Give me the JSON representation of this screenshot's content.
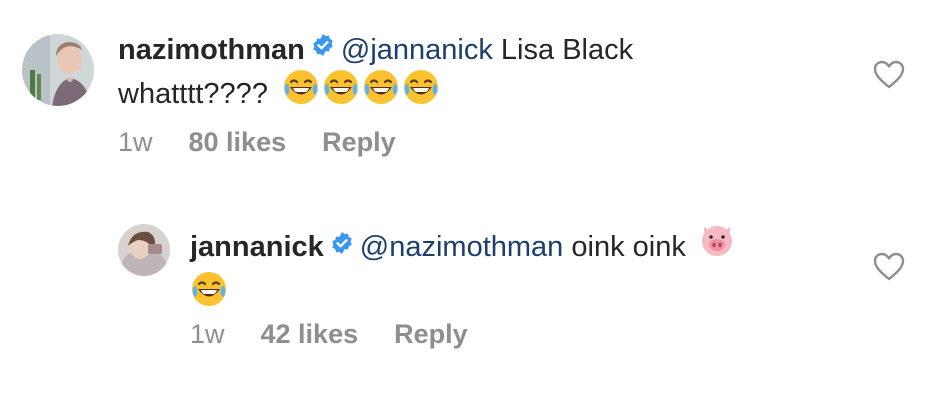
{
  "comments": [
    {
      "username": "nazimothman",
      "mention": "@jannanick",
      "text_after_mention": " Lisa Black",
      "text_line2": "whatttt????",
      "emojis": [
        "laughing-tears",
        "laughing-tears",
        "laughing-tears",
        "laughing-tears"
      ],
      "time": "1w",
      "likes": "80 likes",
      "reply": "Reply",
      "verified": true
    },
    {
      "username": "jannanick",
      "mention": "@nazimothman",
      "text_after_mention": " oink oink",
      "emojis": [
        "pig-face",
        "laughing-tears"
      ],
      "time": "1w",
      "likes": "42 likes",
      "reply": "Reply",
      "verified": true
    }
  ],
  "colors": {
    "text": "#262626",
    "mention": "#1d3e6e",
    "meta": "#8e8e8e",
    "verified": "#3897f0"
  },
  "icons": [
    "verified-badge-icon",
    "heart-outline-icon",
    "laughing-tears-emoji",
    "pig-face-emoji"
  ]
}
